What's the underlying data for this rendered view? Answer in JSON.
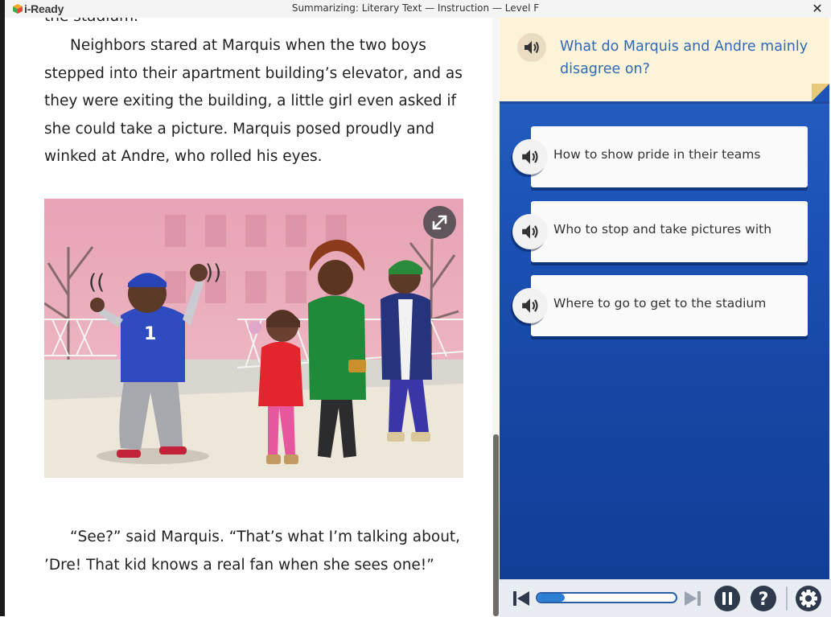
{
  "window": {
    "logo_text": "i-Ready",
    "title": "Summarizing: Literary Text  — Instruction — Level F",
    "close_glyph": "✕"
  },
  "reading": {
    "paragraph_top": "the stadium.",
    "paragraph_1": "Neighbors stared at Marquis when the two boys stepped into their apartment building’s elevator, and as they were exiting the building, a little girl even asked if she could take a picture. Marquis posed proudly and winked at Andre, who rolled his eyes.",
    "paragraph_2": "“See?” said Marquis. “That’s what I’m talking about, ’Dre! That kid knows a real fan when she sees one!”",
    "illustration_jersey_number": "1"
  },
  "question": {
    "text": "What do Marquis and Andre mainly disagree on?",
    "audio_icon": "speaker-icon"
  },
  "answers": [
    {
      "text": "How to show pride in their teams"
    },
    {
      "text": "Who to stop and take pictures with"
    },
    {
      "text": "Where to go to get to the stadium"
    }
  ],
  "controls": {
    "progress": 0.2,
    "icons": [
      "skip-back-icon",
      "skip-forward-icon",
      "pause-icon",
      "help-icon",
      "settings-icon"
    ]
  },
  "colors": {
    "panel_blue": "#1d54b8",
    "question_bg": "#fdf3d8",
    "question_text": "#2f6ab8",
    "progress_fill": "#2d7fd4"
  }
}
